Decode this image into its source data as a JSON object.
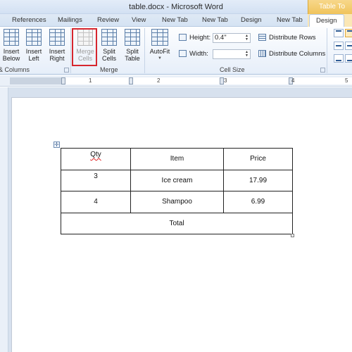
{
  "window": {
    "title": "table.docx - Microsoft Word",
    "context_tab_group": "Table To"
  },
  "tabs": [
    "References",
    "Mailings",
    "Review",
    "View",
    "New Tab",
    "New Tab",
    "Design",
    "New Tab",
    "Design"
  ],
  "ribbon": {
    "rows_columns": {
      "group_label": "& Columns",
      "insert_below": [
        "Insert",
        "Below"
      ],
      "insert_left": [
        "Insert",
        "Left"
      ],
      "insert_right": [
        "Insert",
        "Right"
      ]
    },
    "merge": {
      "group_label": "Merge",
      "merge_cells": [
        "Merge",
        "Cells"
      ],
      "split_cells": [
        "Split",
        "Cells"
      ],
      "split_table": [
        "Split",
        "Table"
      ]
    },
    "cell_size": {
      "group_label": "Cell Size",
      "autofit": "AutoFit",
      "height_label": "Height:",
      "height_value": "0.4\"",
      "width_label": "Width:",
      "width_value": "",
      "distribute_rows": "Distribute Rows",
      "distribute_columns": "Distribute Columns"
    }
  },
  "ruler": {
    "labels": [
      "1",
      "2",
      "3",
      "4",
      "5"
    ]
  },
  "document": {
    "table": {
      "header": [
        "Qty",
        "Item",
        "Price"
      ],
      "rows": [
        [
          "3",
          "Ice cream",
          "17.99"
        ],
        [
          "4",
          "Shampoo",
          "6.99"
        ]
      ],
      "footer": "Total"
    }
  },
  "colors": {
    "highlight_box": "#d6262e",
    "context_tab": "#f0c45c",
    "ribbon_bg": "#e6eef9"
  }
}
